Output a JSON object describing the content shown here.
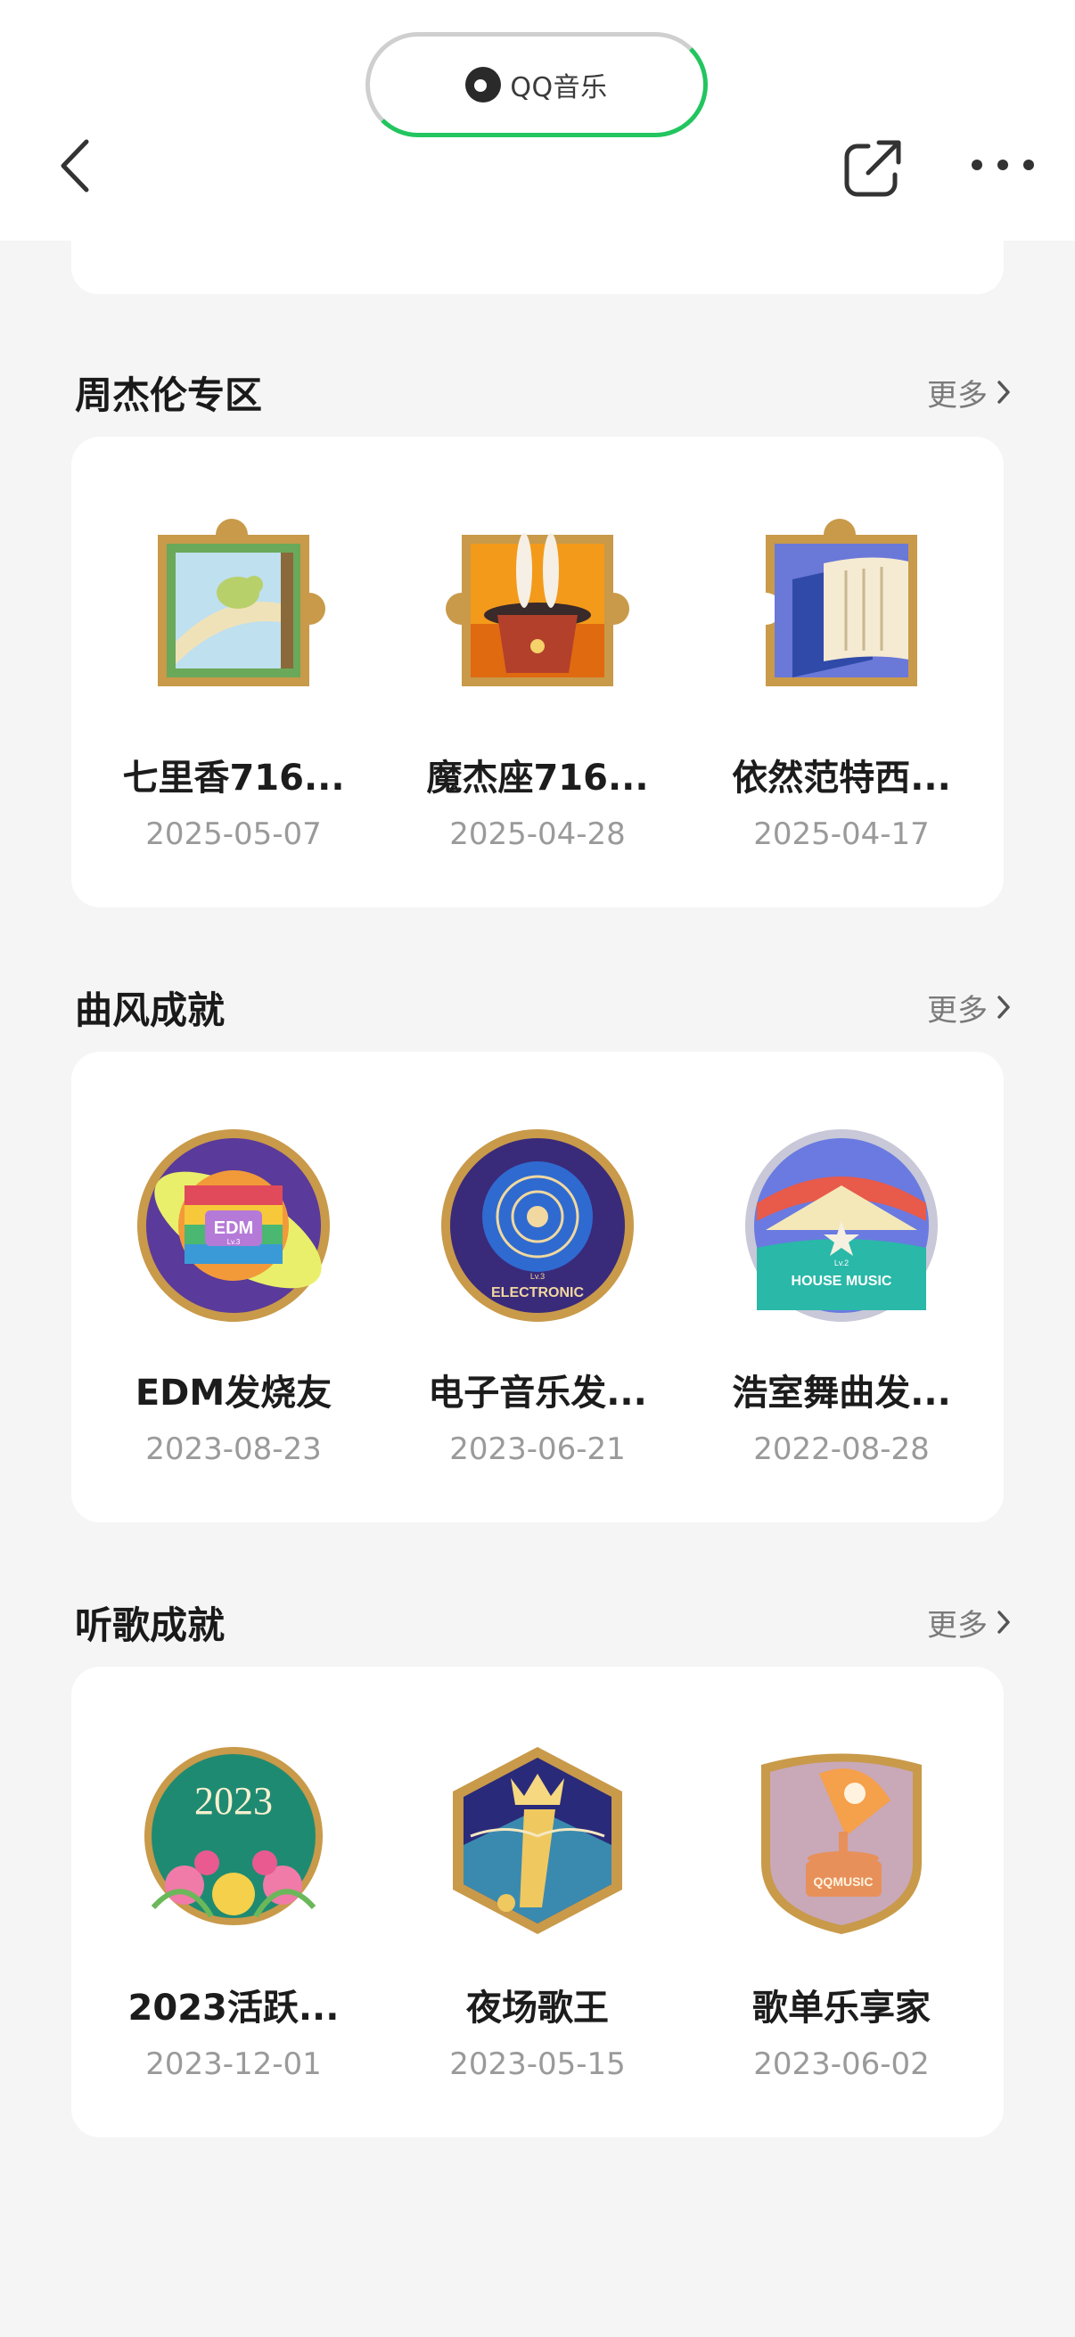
{
  "header": {
    "brand": "QQ音乐",
    "accent_color": "#22c55e",
    "back_icon": "chevron-left-icon",
    "share_icon": "share-icon",
    "more_icon": "more-dots-icon"
  },
  "sections": [
    {
      "title": "周杰伦专区",
      "more_label": "更多",
      "badges": [
        {
          "name": "七里香716...",
          "date": "2025-05-07",
          "icon": "bird-puzzle-badge"
        },
        {
          "name": "魔杰座716...",
          "date": "2025-04-28",
          "icon": "magic-hat-puzzle-badge"
        },
        {
          "name": "依然范特西...",
          "date": "2025-04-17",
          "icon": "scroll-puzzle-badge"
        }
      ]
    },
    {
      "title": "曲风成就",
      "more_label": "更多",
      "badges": [
        {
          "name": "EDM发烧友",
          "date": "2023-08-23",
          "icon": "edm-globe-badge"
        },
        {
          "name": "电子音乐发...",
          "date": "2023-06-21",
          "icon": "electronic-vinyl-badge"
        },
        {
          "name": "浩室舞曲发...",
          "date": "2022-08-28",
          "icon": "house-music-badge"
        }
      ]
    },
    {
      "title": "听歌成就",
      "more_label": "更多",
      "badges": [
        {
          "name": "2023活跃...",
          "date": "2023-12-01",
          "icon": "year-2023-flower-badge",
          "year_text": "2023"
        },
        {
          "name": "夜场歌王",
          "date": "2023-05-15",
          "icon": "night-king-badge"
        },
        {
          "name": "歌单乐享家",
          "date": "2023-06-02",
          "icon": "gramophone-badge",
          "label_text": "QQMUSIC"
        }
      ]
    }
  ],
  "badge_texts": {
    "edm": "EDM",
    "edm_level": "Lv.3",
    "electronic": "ELECTRONIC",
    "electronic_level": "Lv.3",
    "house": "HOUSE MUSIC",
    "house_level": "Lv.2"
  }
}
